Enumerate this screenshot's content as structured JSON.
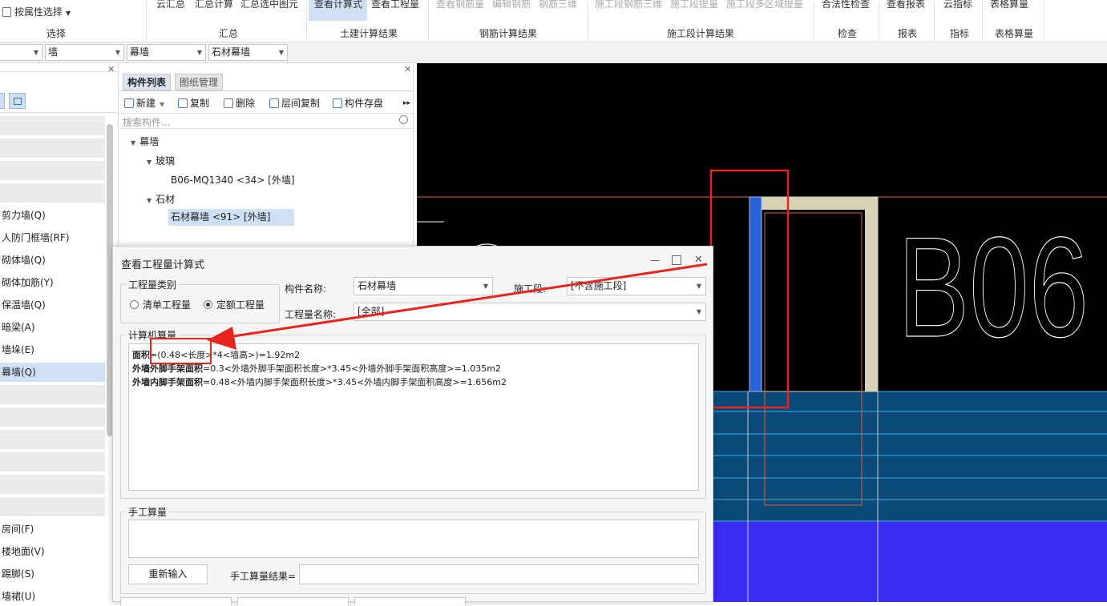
{
  "ribbon": {
    "select_by_attr": "按属性选择",
    "cloud_summary": "云汇总",
    "summary_calc": "汇总计算",
    "summary_selected": "汇总选中图元",
    "view_formula": "查看计算式",
    "view_quantity": "查看工程量",
    "view_rebar_qty": "查看钢筋量",
    "edit_rebar": "编辑钢筋",
    "rebar_3d": "钢筋三维",
    "seg_rebar_3d": "施工段钢筋三维",
    "seg_extract": "施工段提量",
    "seg_multi_extract": "施工段多区域提量",
    "legality_check": "合法性检查",
    "view_report": "查看报表",
    "cloud_index": "云指标",
    "table_calc": "表格算量",
    "groups": {
      "select": "选择",
      "summary": "汇总",
      "civil_result": "土建计算结果",
      "rebar_result": "钢筋计算结果",
      "segment_result": "施工段计算结果",
      "check": "检查",
      "report": "报表",
      "index": "指标",
      "table": "表格算量"
    }
  },
  "filters": {
    "type": "墙",
    "subtype": "幕墙",
    "item": "石材幕墙"
  },
  "left_panel": {
    "items": [
      {
        "label": "剪力墙(Q)"
      },
      {
        "label": "人防门框墙(RF)"
      },
      {
        "label": "砌体墙(Q)"
      },
      {
        "label": "砌体加筋(Y)"
      },
      {
        "label": "保温墙(Q)"
      },
      {
        "label": "暗梁(A)"
      },
      {
        "label": "墙垛(E)"
      },
      {
        "label": "幕墙(Q)"
      },
      {
        "label": "房间(F)"
      },
      {
        "label": "楼地面(V)"
      },
      {
        "label": "踢脚(S)"
      },
      {
        "label": "墙裙(U)"
      }
    ]
  },
  "component_panel": {
    "tab_list": "构件列表",
    "tab_drawing": "图纸管理",
    "btn_new": "新建",
    "btn_copy": "复制",
    "btn_delete": "删除",
    "btn_floor_copy": "层间复制",
    "btn_store": "构件存盘",
    "search_placeholder": "搜索构件...",
    "tree": {
      "root": "幕墙",
      "glass": "玻璃",
      "glass_item": "B06-MQ1340 <34> [外墙]",
      "stone": "石材",
      "stone_item": "石材幕墙 <91> [外墙]"
    }
  },
  "cad": {
    "text_b06": "B06",
    "partial_text": "0",
    "colors": {
      "background": "#000000",
      "red_line": "#e0603a",
      "wall_blue": "#2a62d6",
      "beige": "#d6d2b6",
      "teal": "#0b4a78",
      "blue_slab": "#3a2cf0"
    }
  },
  "dialog": {
    "title": "查看工程量计算式",
    "qty_type_label": "工程量类别",
    "radio_list": "清单工程量",
    "radio_quota": "定额工程量",
    "comp_name_label": "构件名称:",
    "comp_name_value": "石材幕墙",
    "seg_label": "施工段:",
    "seg_value": "[不含施工段]",
    "qty_name_label": "工程量名称:",
    "qty_name_value": "[全部]",
    "computer_calc_label": "计算机算量",
    "formula1_name": "面积",
    "formula1_body": "=(0.48<长度>*4<墙高>)=1.92m2",
    "formula2_name": "外墙外脚手架面积",
    "formula2_body": "=0.3<外墙外脚手架面积长度>*3.45<外墙外脚手架面积高度>=1.035m2",
    "formula3_name": "外墙内脚手架面积",
    "formula3_body": "=0.48<外墙内脚手架面积长度>*3.45<外墙内脚手架面积高度>=1.656m2",
    "manual_calc_label": "手工算量",
    "reinput_button": "重新输入",
    "manual_result_label": "手工算量结果="
  },
  "annotation_color": "#e8251c"
}
